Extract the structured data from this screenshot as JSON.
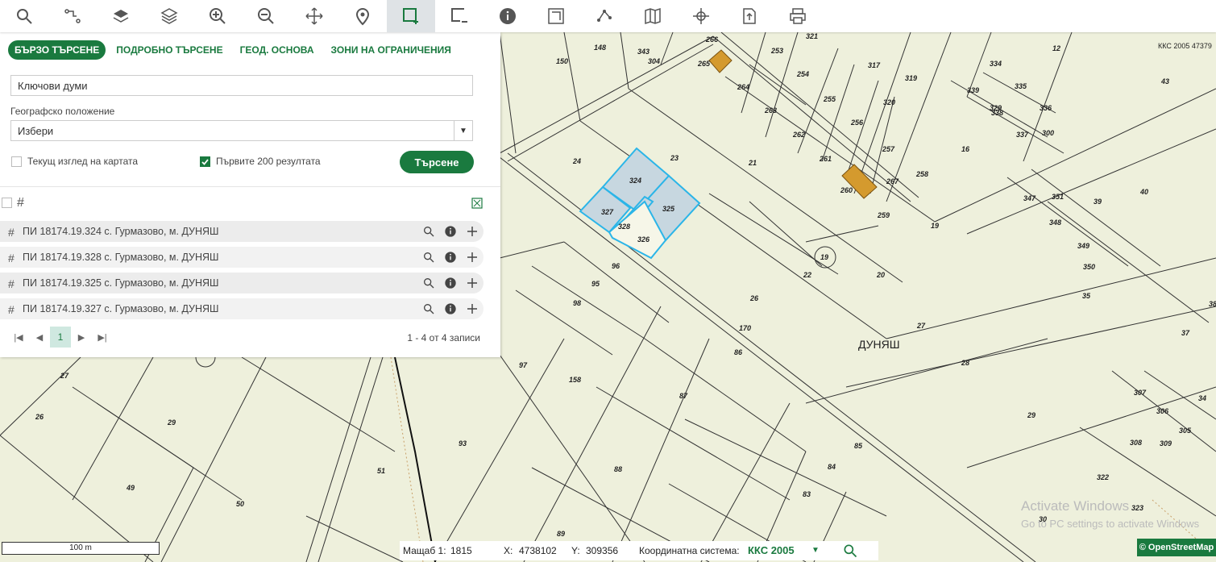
{
  "toolbar": {
    "buttons": [
      {
        "name": "search-icon"
      },
      {
        "name": "route-icon"
      },
      {
        "name": "layers-icon"
      },
      {
        "name": "layers-stack-icon"
      },
      {
        "name": "zoom-in-icon"
      },
      {
        "name": "zoom-out-icon"
      },
      {
        "name": "pan-move-icon"
      },
      {
        "name": "location-pin-icon"
      },
      {
        "name": "select-area-add-icon",
        "active": true
      },
      {
        "name": "select-area-remove-icon"
      },
      {
        "name": "info-icon"
      },
      {
        "name": "measure-icon"
      },
      {
        "name": "polyline-icon"
      },
      {
        "name": "map-icon"
      },
      {
        "name": "coordinates-icon"
      },
      {
        "name": "export-icon"
      },
      {
        "name": "print-icon"
      }
    ]
  },
  "panel": {
    "tabs": [
      "БЪРЗО ТЪРСЕНЕ",
      "ПОДРОБНО ТЪРСЕНЕ",
      "ГЕОД. ОСНОВА",
      "ЗОНИ НА ОГРАНИЧЕНИЯ"
    ],
    "keywords_placeholder": "Ключови думи",
    "geo_label": "Географско положение",
    "geo_value": "Избери",
    "checkbox_current_view": {
      "label": "Текущ изглед на картата",
      "checked": false
    },
    "checkbox_first200": {
      "label": "Първите 200 резултата",
      "checked": true
    },
    "search_button": "Търсене",
    "results": [
      "ПИ 18174.19.324 с. Гурмазово, м. ДУНЯШ",
      "ПИ 18174.19.328 с. Гурмазово, м. ДУНЯШ",
      "ПИ 18174.19.325 с. Гурмазово, м. ДУНЯШ",
      "ПИ 18174.19.327 с. Гурмазово, м. ДУНЯШ"
    ],
    "pager": {
      "current": "1",
      "records": "1 - 4 от 4 записи"
    }
  },
  "map": {
    "kks_label": "ККС 2005 47379",
    "locality": "ДУНЯШ",
    "parcel_labels": [
      "266",
      "321",
      "265",
      "148",
      "343",
      "304",
      "150",
      "253",
      "254",
      "317",
      "319",
      "12",
      "334",
      "335",
      "339",
      "43",
      "264",
      "263",
      "255",
      "320",
      "329",
      "336",
      "338",
      "337",
      "300",
      "256",
      "262",
      "257",
      "16",
      "261",
      "258",
      "24",
      "23",
      "21",
      "324",
      "260",
      "267",
      "347",
      "351",
      "39",
      "40",
      "327",
      "325",
      "328",
      "259",
      "19",
      "348",
      "326",
      "349",
      "350",
      "96",
      "19",
      "22",
      "20",
      "95",
      "35",
      "98",
      "26",
      "38",
      "27",
      "37",
      "170",
      "ДУНЯШ",
      "97",
      "86",
      "28",
      "27",
      "158",
      "87",
      "307",
      "34",
      "26",
      "29",
      "29",
      "306",
      "309",
      "305",
      "93",
      "85",
      "308",
      "49",
      "51",
      "88",
      "84",
      "322",
      "50",
      "83",
      "323",
      "89",
      "30"
    ],
    "watermark_1": "Activate Windows",
    "watermark_2": "Go to PC settings to activate Windows"
  },
  "status": {
    "scale_label": "Мащаб 1:",
    "scale_value": "1815",
    "x_label": "X:",
    "x_value": "4738102",
    "y_label": "Y:",
    "y_value": "309356",
    "crs_label": "Координатна система:",
    "crs_value": "ККС 2005",
    "scalebar_text": "100 m",
    "osm_text": "© OpenStreetMap"
  },
  "colors": {
    "accent": "#1a7a3f",
    "map_bg": "#eef0dc",
    "parcel_line": "#333333",
    "selected_fill": "#c7d7e0",
    "selected_stroke": "#2bb5e8",
    "building": "#d49a2e"
  }
}
